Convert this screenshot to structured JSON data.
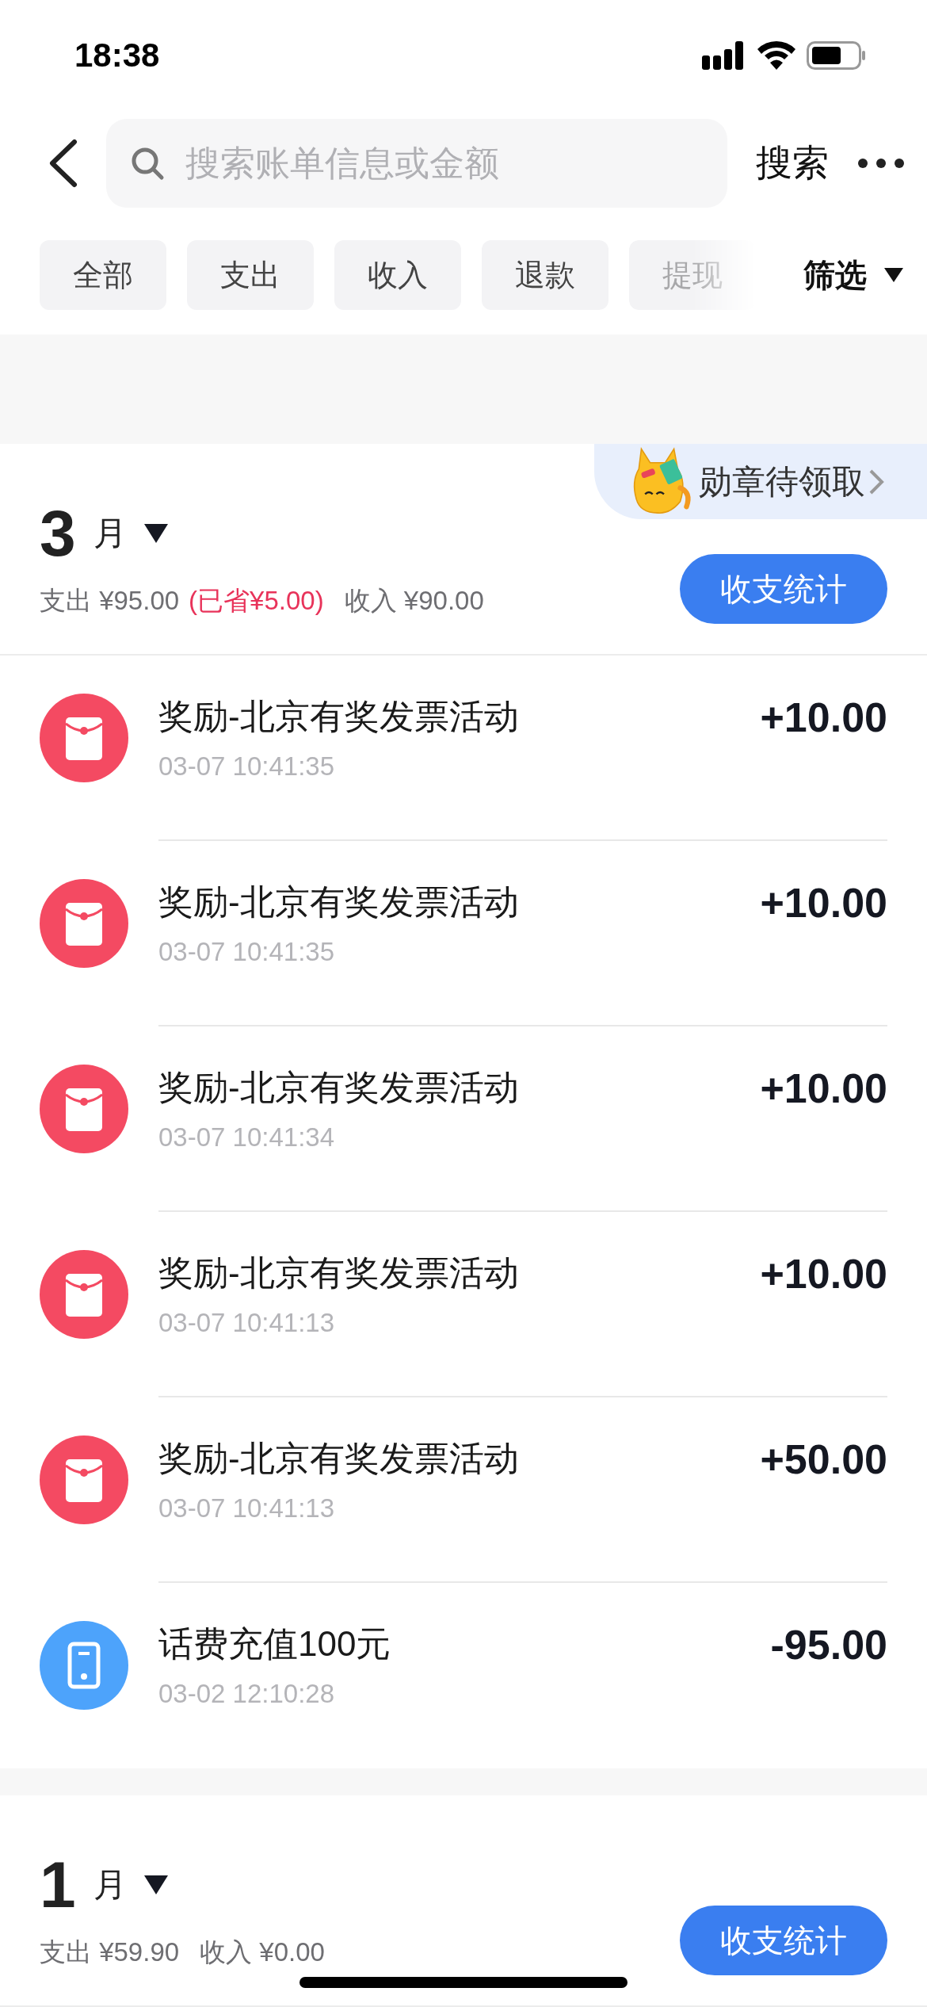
{
  "status_bar": {
    "time": "18:38"
  },
  "search": {
    "placeholder": "搜索账单信息或金额",
    "button": "搜索"
  },
  "filters": [
    {
      "label": "全部",
      "faded": false
    },
    {
      "label": "支出",
      "faded": false
    },
    {
      "label": "收入",
      "faded": false
    },
    {
      "label": "退款",
      "faded": false
    },
    {
      "label": "提现",
      "faded": true
    }
  ],
  "filter_menu": "筛选",
  "months": [
    {
      "month": "3",
      "unit": "月",
      "badge": "勋章待领取",
      "summary": [
        {
          "kind": "normal",
          "text": "支出 ¥95.00"
        },
        {
          "kind": "saving",
          "text": "(已省¥5.00)"
        },
        {
          "kind": "normal",
          "text": "收入 ¥90.00"
        }
      ],
      "stats_button": "收支统计",
      "transactions": [
        {
          "kind": "red_packet",
          "title": "奖励-北京有奖发票活动",
          "time": "03-07 10:41:35",
          "amount": "+10.00"
        },
        {
          "kind": "red_packet",
          "title": "奖励-北京有奖发票活动",
          "time": "03-07 10:41:35",
          "amount": "+10.00"
        },
        {
          "kind": "red_packet",
          "title": "奖励-北京有奖发票活动",
          "time": "03-07 10:41:34",
          "amount": "+10.00"
        },
        {
          "kind": "red_packet",
          "title": "奖励-北京有奖发票活动",
          "time": "03-07 10:41:13",
          "amount": "+10.00"
        },
        {
          "kind": "red_packet",
          "title": "奖励-北京有奖发票活动",
          "time": "03-07 10:41:13",
          "amount": "+50.00"
        },
        {
          "kind": "phone",
          "title": "话费充值100元",
          "time": "03-02 12:10:28",
          "amount": "-95.00"
        }
      ]
    },
    {
      "month": "1",
      "unit": "月",
      "summary": [
        {
          "kind": "normal",
          "text": "支出 ¥59.90"
        },
        {
          "kind": "normal",
          "text": "收入 ¥0.00"
        }
      ],
      "stats_button": "收支统计"
    }
  ]
}
